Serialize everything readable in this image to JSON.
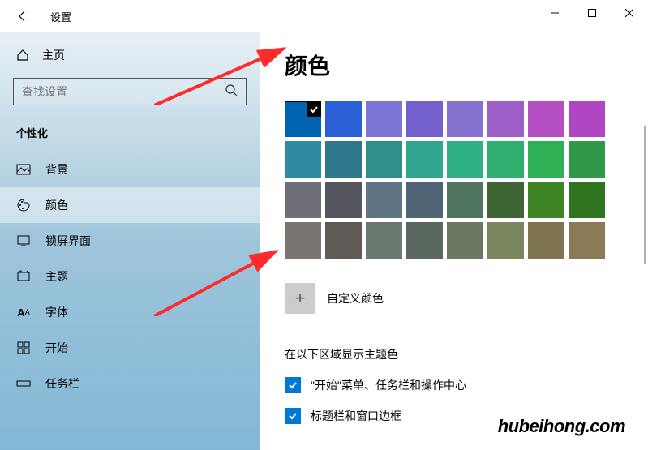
{
  "titlebar": {
    "title": "设置"
  },
  "sidebar": {
    "home_label": "主页",
    "search_placeholder": "查找设置",
    "section_label": "个性化",
    "items": [
      {
        "label": "背景"
      },
      {
        "label": "颜色"
      },
      {
        "label": "锁屏界面"
      },
      {
        "label": "主题"
      },
      {
        "label": "字体"
      },
      {
        "label": "开始"
      },
      {
        "label": "任务栏"
      }
    ]
  },
  "main": {
    "title": "颜色",
    "custom_color_label": "自定义颜色",
    "accent_section_label": "在以下区域显示主题色",
    "checkboxes": [
      {
        "label": "\"开始\"菜单、任务栏和操作中心"
      },
      {
        "label": "标题栏和窗口边框"
      }
    ],
    "color_grid": {
      "selected_index": 0,
      "colors": [
        "#0063b1",
        "#2a5fd6",
        "#7b75d6",
        "#7460cc",
        "#8573cf",
        "#9b5fc7",
        "#b34fc0",
        "#b146c2",
        "#2f8aa0",
        "#2f788c",
        "#2f8f8a",
        "#2fa58f",
        "#2fb087",
        "#2fb070",
        "#2fb055",
        "#2f9849",
        "#6f6f77",
        "#55555f",
        "#5f7585",
        "#4f6575",
        "#4f755f",
        "#3f6535",
        "#3f8525",
        "#2f7520",
        "#7a7570",
        "#5f5a55",
        "#6a7870",
        "#5a6860",
        "#6a7862",
        "#7a8660",
        "#7f7550",
        "#8a7a55"
      ]
    }
  },
  "watermark": "hubeihong.com"
}
